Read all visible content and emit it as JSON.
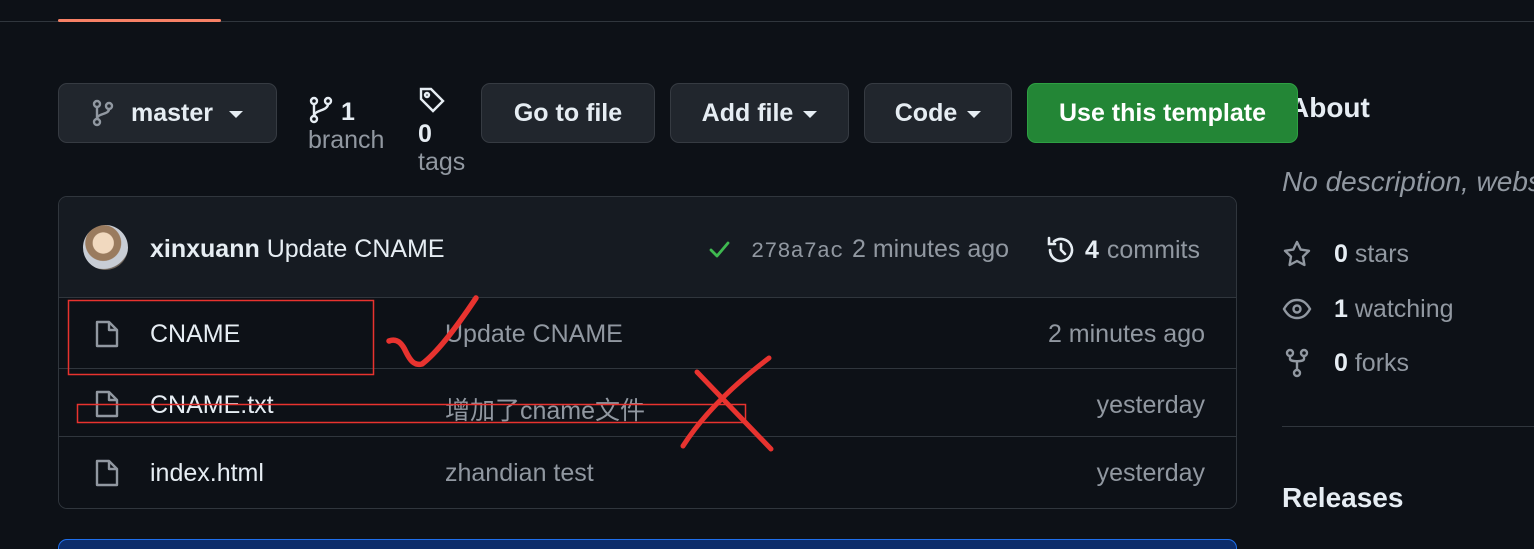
{
  "toolbar": {
    "branch_name": "master",
    "branch_count": "1",
    "branch_label": "branch",
    "tag_count": "0",
    "tag_label": "tags",
    "go_to_file": "Go to file",
    "add_file": "Add file",
    "code": "Code",
    "use_template": "Use this template"
  },
  "latest_commit": {
    "author": "xinxuann",
    "message": "Update CNAME",
    "status": "success",
    "sha": "278a7ac",
    "time": "2 minutes ago",
    "commit_count": "4",
    "commits_label": "commits"
  },
  "files": [
    {
      "name": "CNAME",
      "message": "Update CNAME",
      "time": "2 minutes ago",
      "icon": "file-icon"
    },
    {
      "name": "CNAME.txt",
      "message": "增加了cname文件",
      "time": "yesterday",
      "icon": "file-icon"
    },
    {
      "name": "index.html",
      "message": "zhandian test",
      "time": "yesterday",
      "icon": "file-icon"
    }
  ],
  "sidebar": {
    "about_title": "About",
    "description": "No description, website",
    "stars_count": "0",
    "stars_label": "stars",
    "watching_count": "1",
    "watching_label": "watching",
    "forks_count": "0",
    "forks_label": "forks",
    "releases_title": "Releases"
  },
  "colors": {
    "background": "#0d1117",
    "accent_green": "#238636",
    "tab_underline": "#f78166",
    "annotation_red": "#e8332f"
  }
}
